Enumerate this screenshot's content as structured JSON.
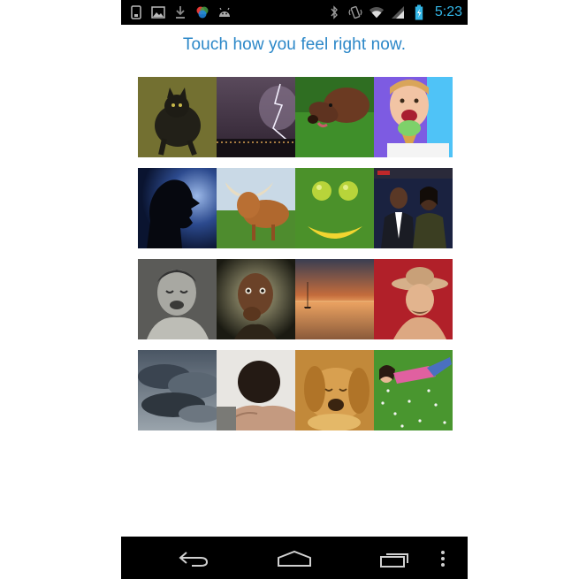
{
  "status_bar": {
    "time": "5:23",
    "left_icons": [
      "phone-icon",
      "gallery-icon",
      "download-icon",
      "color-wheel-icon",
      "android-icon"
    ],
    "right_icons": [
      "bluetooth-icon",
      "vibrate-icon",
      "wifi-icon",
      "signal-icon",
      "battery-charging-icon"
    ],
    "accent_color": "#33b5e5"
  },
  "prompt": {
    "text": "Touch how you feel right now.",
    "color": "#2b87c8"
  },
  "mood_grid": {
    "rows": [
      {
        "tiles": [
          "cat-photo",
          "lightning-photo",
          "dog-photo",
          "girl-ice-cream-photo"
        ]
      },
      {
        "tiles": [
          "shouting-silhouette-photo",
          "highland-cow-photo",
          "apples-banana-smiley-photo",
          "couple-photo"
        ]
      },
      {
        "tiles": [
          "crying-child-photo",
          "child-thinking-photo",
          "sunset-lake-photo",
          "man-hat-photo"
        ]
      },
      {
        "tiles": [
          "storm-clouds-photo",
          "head-down-photo",
          "sleeping-dog-photo",
          "woman-grass-photo"
        ]
      }
    ]
  },
  "nav_bar": {
    "buttons": [
      "back-icon",
      "home-icon",
      "recent-apps-icon",
      "menu-icon"
    ]
  }
}
